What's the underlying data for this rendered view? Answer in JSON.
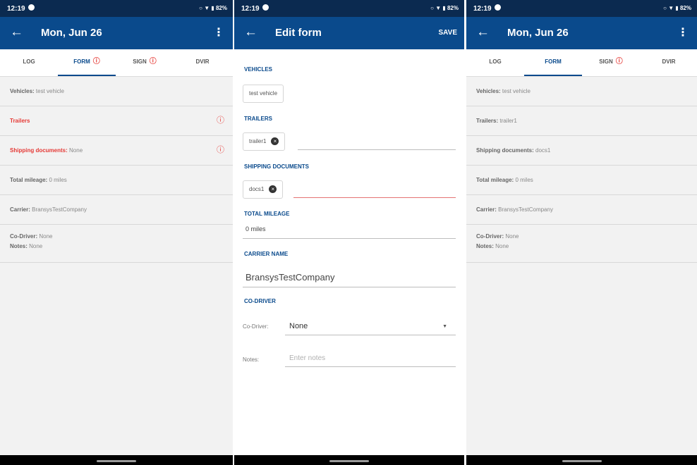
{
  "status_bar": {
    "time": "12:19",
    "right": "○ ▼ ▮ 82%"
  },
  "screen_left": {
    "back_icon": "←",
    "title": "Mon, Jun 26",
    "menu_icon": "⋮",
    "tabs": [
      {
        "label": "LOG",
        "alert": false
      },
      {
        "label": "FORM",
        "alert": true
      },
      {
        "label": "SIGN",
        "alert": true
      },
      {
        "label": "DVIR",
        "alert": false
      }
    ],
    "rows": [
      {
        "label": "Vehicles:",
        "value": "test vehicle",
        "error": false
      },
      {
        "label": "Trailers",
        "value": "",
        "error": true
      },
      {
        "label": "Shipping documents:",
        "value": "None",
        "error": true
      },
      {
        "label": "Total mileage:",
        "value": "0 miles",
        "error": false
      },
      {
        "label": "Carrier:",
        "value": "BransysTestCompany",
        "error": false
      }
    ],
    "co_driver": {
      "label": "Co-Driver:",
      "value": "None"
    },
    "notes": {
      "label": "Notes:",
      "value": "None"
    },
    "alert_icon": "ⓘ"
  },
  "screen_edit": {
    "back_icon": "←",
    "title": "Edit form",
    "save_label": "SAVE",
    "vehicles": {
      "title": "VEHICLES",
      "chip": "test vehicle"
    },
    "trailers": {
      "title": "TRAILERS",
      "chip": "trailer1"
    },
    "shipping": {
      "title": "SHIPPING DOCUMENTS",
      "chip": "docs1"
    },
    "mileage": {
      "title": "TOTAL MILEAGE",
      "value": "0 miles"
    },
    "carrier": {
      "title": "CARRIER NAME",
      "value": "BransysTestCompany"
    },
    "co_driver": {
      "title": "CO-DRIVER",
      "label": "Co-Driver:",
      "value": "None"
    },
    "notes": {
      "label": "Notes:",
      "placeholder": "Enter notes"
    },
    "remove_icon": "×",
    "dropdown_icon": "▼"
  },
  "screen_right": {
    "back_icon": "←",
    "title": "Mon, Jun 26",
    "menu_icon": "⋮",
    "tabs": [
      {
        "label": "LOG",
        "alert": false
      },
      {
        "label": "FORM",
        "alert": false
      },
      {
        "label": "SIGN",
        "alert": true
      },
      {
        "label": "DVIR",
        "alert": false
      }
    ],
    "rows": [
      {
        "label": "Vehicles:",
        "value": "test vehicle"
      },
      {
        "label": "Trailers:",
        "value": "trailer1"
      },
      {
        "label": "Shipping documents:",
        "value": "docs1"
      },
      {
        "label": "Total mileage:",
        "value": "0 miles"
      },
      {
        "label": "Carrier:",
        "value": "BransysTestCompany"
      }
    ],
    "co_driver": {
      "label": "Co-Driver:",
      "value": "None"
    },
    "notes": {
      "label": "Notes:",
      "value": "None"
    },
    "alert_icon": "ⓘ"
  },
  "colors": {
    "appbar": "#0a4a8c",
    "statusbar": "#0b2a50",
    "error": "#e53935"
  }
}
